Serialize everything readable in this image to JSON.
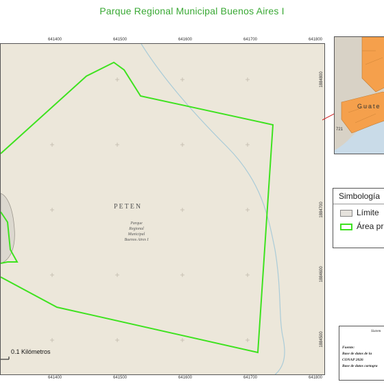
{
  "map": {
    "title": "Parque Regional Municipal Buenos Aires I",
    "x_ticks": [
      "641400",
      "641500",
      "641600",
      "641700",
      "641800"
    ],
    "y_ticks": [
      "1884800",
      "1884700",
      "1884600",
      "1884500"
    ],
    "region_label": "PETEN",
    "park_label": [
      "Parque",
      "Regional",
      "Municipal",
      "Buenos Aires I"
    ],
    "scale_label": "0.1 Kilómetros",
    "colors": {
      "boundary": "#3ee21f",
      "background": "#ece7da",
      "river": "#a9cbd8"
    }
  },
  "inset": {
    "country_label": "Guate",
    "small_label": "721",
    "colors": {
      "land": "#f5a04c",
      "sea": "#c9dbe8",
      "pointer": "#d42b2b"
    }
  },
  "legend": {
    "title": "Simbología",
    "items": [
      {
        "label": "Límite",
        "icon": "gray-box-swatch"
      },
      {
        "label": "Área pr",
        "icon": "green-outline-swatch"
      }
    ]
  },
  "info": {
    "heading": "Sistem",
    "lines": [
      "Fuente:",
      "Base de datos de la",
      "CONAP 2026",
      "Base de datos cartogra"
    ]
  }
}
